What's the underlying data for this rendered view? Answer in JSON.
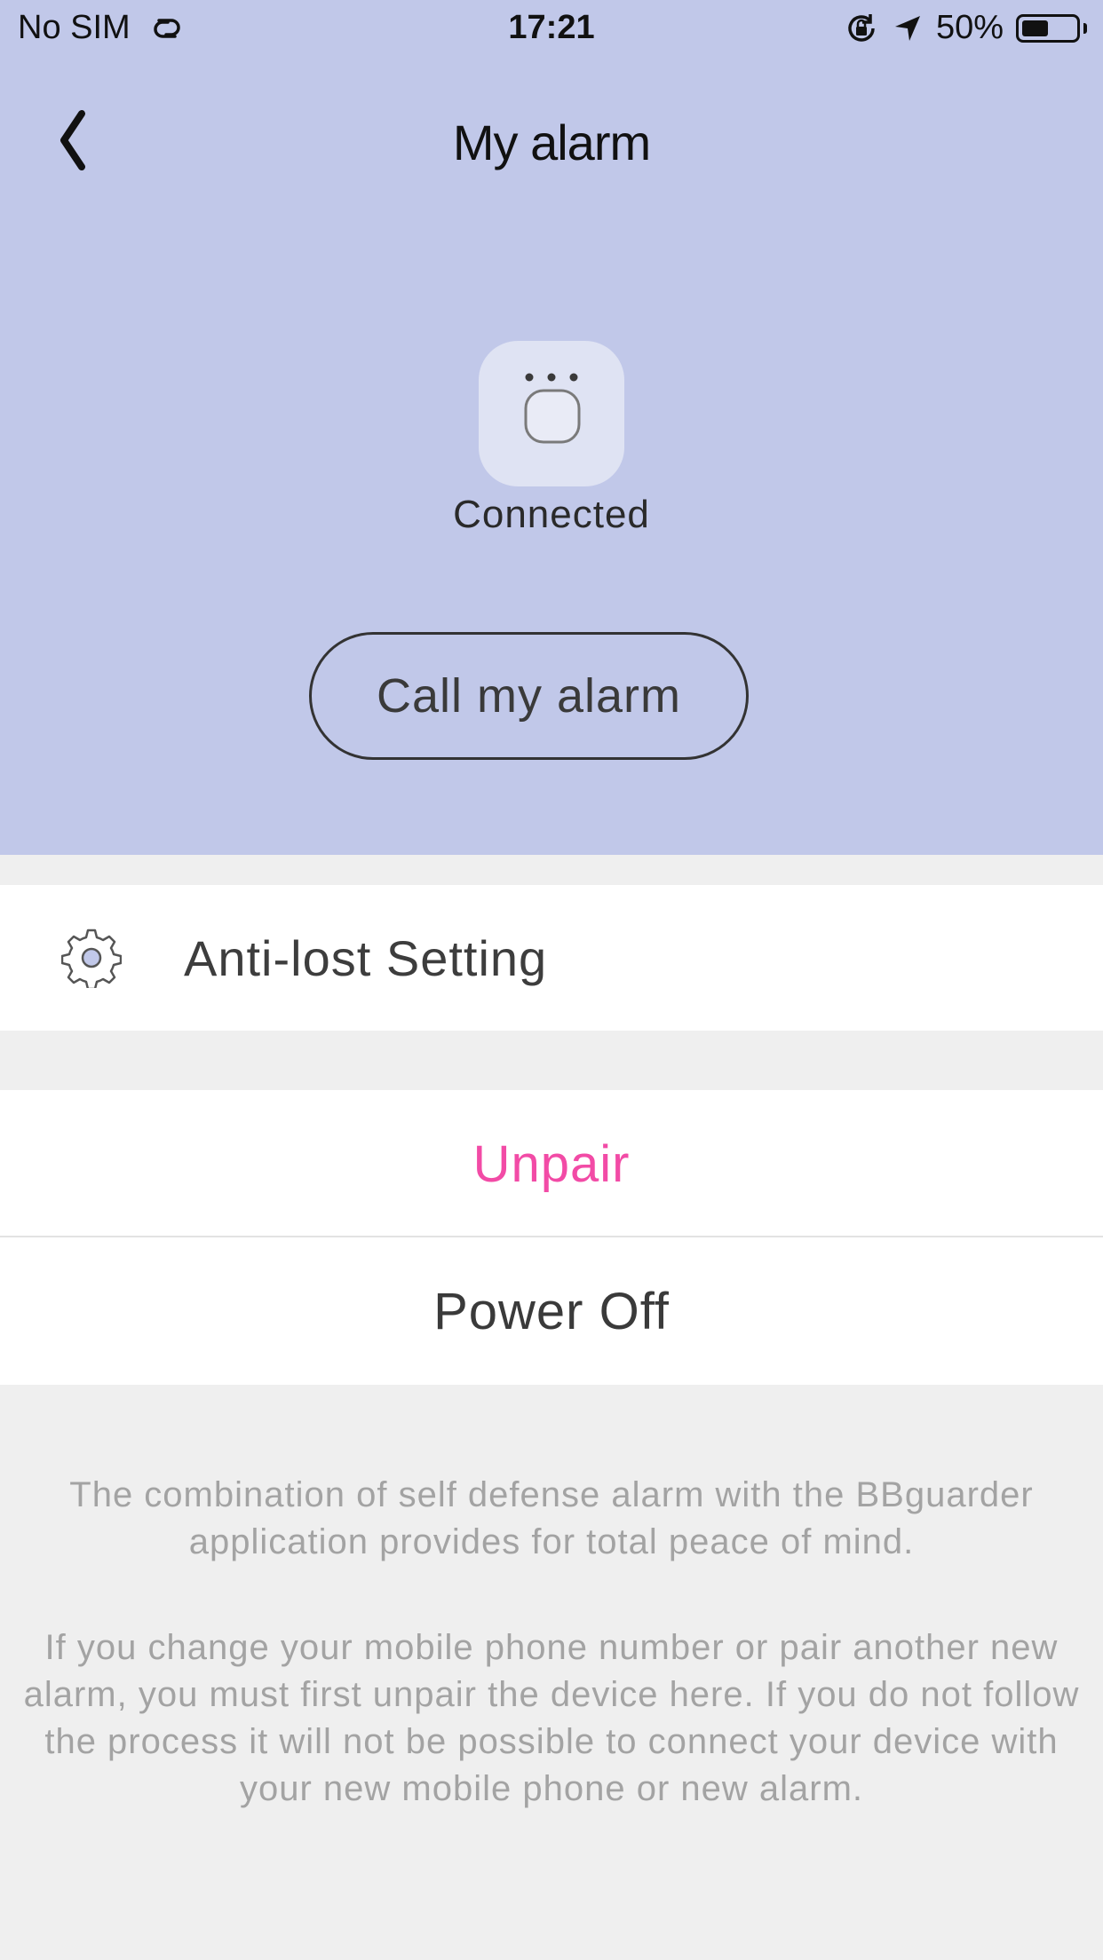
{
  "status_bar": {
    "carrier": "No SIM",
    "time": "17:21",
    "battery": "50%",
    "battery_level": 0.5,
    "icons": [
      "link-icon",
      "orientation-lock-icon",
      "location-arrow-icon",
      "battery-icon"
    ]
  },
  "nav": {
    "title": "My alarm",
    "back_icon": "chevron-left-icon"
  },
  "device": {
    "icon": "alarm-device-icon",
    "status": "Connected"
  },
  "actions": {
    "call_label": "Call my alarm"
  },
  "settings": {
    "anti_lost_label": "Anti-lost Setting",
    "icon": "gear-icon"
  },
  "menu": {
    "unpair_label": "Unpair",
    "power_off_label": "Power Off"
  },
  "info": {
    "paragraph_1": "The combination of self defense alarm with the BBguarder application provides for total peace of mind.",
    "paragraph_2": "If you change your mobile phone number or pair another new alarm, you must first unpair the device here. If you do not follow the process it will not be possible to connect your device with your new mobile phone or new alarm."
  },
  "colors": {
    "header_bg": "#c1c8e9",
    "page_bg": "#efefef",
    "unpair": "#f24ba6",
    "info_text": "#a3a3a3"
  }
}
